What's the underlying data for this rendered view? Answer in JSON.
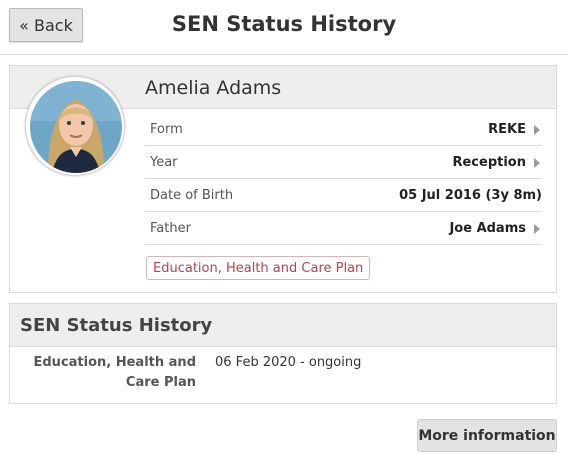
{
  "header": {
    "back_label": "« Back",
    "title": "SEN Status History"
  },
  "student": {
    "name": "Amelia Adams",
    "photo_icon": "student-photo",
    "rows": [
      {
        "label": "Form",
        "value": "REKE"
      },
      {
        "label": "Year",
        "value": "Reception"
      },
      {
        "label": "Date of Birth",
        "value": "05 Jul 2016 (3y 8m)"
      },
      {
        "label": "Father",
        "value": "Joe Adams"
      }
    ],
    "sen_badge": "Education, Health and Care Plan"
  },
  "history": {
    "title": "SEN Status History",
    "entries": [
      {
        "type": "Education, Health and Care Plan",
        "period": "06 Feb 2020 - ongoing"
      }
    ]
  },
  "footer": {
    "more_label": "More information"
  },
  "colors": {
    "badge_text": "#b0454e",
    "header_bg": "#eeeeee",
    "button_bg": "#e3e3e3"
  }
}
